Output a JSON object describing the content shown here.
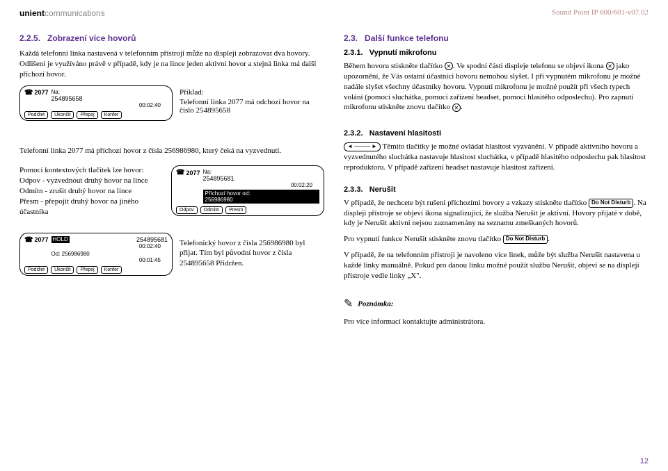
{
  "header": {
    "brand_bold": "unient",
    "brand_light": "communications",
    "doc_id": "Sound Point IP 600/601-v07.02"
  },
  "left": {
    "s225": {
      "num": "2.2.5.",
      "title": "Zobrazení více hovorů",
      "p1": "Každá telefonní linka nastavená v telefonním přístroji může na displeji zobrazovat dva hovory. Odlišení je využíváno právě v případě, kdy je na lince jeden aktivní hovor a stejná linka má další příchozí hovor.",
      "example_label": "Příklad:",
      "example_text": "Telefonní linka 2077 má odchozí hovor na číslo 254895658",
      "p2": "Telefonní linka 2077 má příchozí hovor z čísla  256986980, který čeká na vyzvednutí.",
      "context_intro": "Pomocí kontextových tlačítek lze hovor:",
      "ctx1": "Odpov - vyzvednout druhý hovor na lince",
      "ctx2": "Odmítn - zrušit druhý hovor na lince",
      "ctx3": "Přesm - přepojit druhý hovor na jiného účastníka",
      "p3": "Telefonický hovor z čísla 256986980 byl přijat. Tím byl původní hovor z čísla 254895658 Přidržen."
    },
    "display1": {
      "ext": "2077",
      "na": "Na:",
      "num": "254895658",
      "dur": "00:02:40",
      "k1": "Podržet",
      "k2": "Ukončit",
      "k3": "Přepoj",
      "k4": "Konfer"
    },
    "display2": {
      "ext": "2077",
      "na": "Na:",
      "num": "254895681",
      "dur": "00:02:20",
      "incoming_lbl": "Příchozí hovor od:",
      "incoming_num": "256986980",
      "k1": "Odpov",
      "k2": "Odmitn",
      "k3": "Presm"
    },
    "display3": {
      "ext": "2077",
      "hold": "HOLD",
      "num": "254895681",
      "dur": "00:02:40",
      "od": "Od:",
      "num2": "256986980",
      "dur2": "00:01:45",
      "k1": "Podržet",
      "k2": "Ukončit",
      "k3": "Přepoj",
      "k4": "Konfer"
    }
  },
  "right": {
    "s23": {
      "num": "2.3.",
      "title": "Další funkce telefonu"
    },
    "s231": {
      "num": "2.3.1.",
      "title": "Vypnutí mikrofonu",
      "pa": "Během hovoru stiskněte tlačítko",
      "pb": ". Ve spodní části displeje telefonu se objeví ikona",
      "pc": "jako upozornění, že Vás ostatní účastníci hovoru nemohou slyšet. I při vypnutém mikrofonu je možné nadále slyšet všechny účastníky hovoru. Vypnutí mikrofonu je možné použít při všech typech volání (pomocí sluchátka, pomocí zařízení headset, pomocí hlasitého odposlechu). Pro zapnutí mikrofonu stiskněte znovu tlačítko",
      "mute": "✕"
    },
    "s232": {
      "num": "2.3.2.",
      "title": "Nastavení hlasitosti",
      "vol": "◄ ──── ►",
      "p": "Těmito tlačítky je možné ovládat hlasitost vyzvánění. V případě aktivního hovoru a vyzvednutého sluchátka nastavuje hlasitost sluchátka, v případě hlasitého odposlechu pak hlasitost reproduktoru. V případě zařízení headset nastavuje hlasitost zařízení."
    },
    "s233": {
      "num": "2.3.3.",
      "title": "Nerušit",
      "pa": "V případě, že nechcete být rušeni příchozími hovory a vzkazy stiskněte tlačítko",
      "dnd": "Do Not Disturb",
      "pb": ". Na displeji přístroje se objeví ikona signalizující, že služba Nerušit je aktivní. Hovory přijaté v době, kdy je Nerušit aktivní nejsou zaznamenány na seznamu zmeškaných hovorů.",
      "pc": "Pro vypnutí funkce Nerušit stiskněte znovu tlačítko",
      "pd": "V případě, že na telefonním přístroji je navoleno více linek, může být služba Nerušit nastavena u každé linky manuálně. Pokud pro danou linku možné použít službu Nerušit, objeví se na displeji přístroje vedle linky „X\"."
    },
    "note": {
      "label": "Poznámka:",
      "text": "Pro více informací kontaktujte administrátora."
    }
  },
  "page_num": "12"
}
